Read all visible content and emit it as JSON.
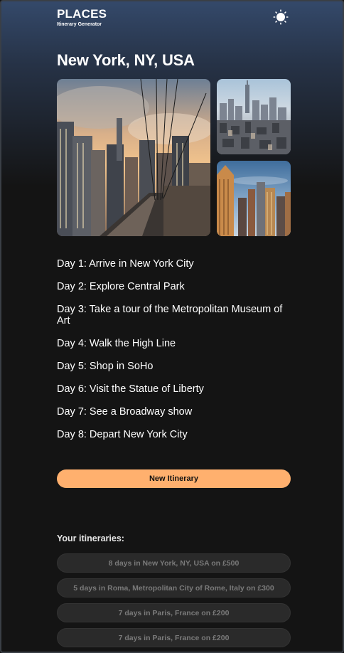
{
  "header": {
    "brand": "PLACES",
    "subtitle": "Itinerary Generator",
    "theme_icon": "sun-icon"
  },
  "destination": {
    "title": "New York, NY, USA",
    "photos": [
      "city-skyline-bridge-photo",
      "aerial-manhattan-photo",
      "skyscrapers-sunset-photo"
    ]
  },
  "itinerary": {
    "days": [
      "Day 1: Arrive in New York City",
      "Day 2: Explore Central Park",
      "Day 3: Take a tour of the Metropolitan Museum of Art",
      "Day 4: Walk the High Line",
      "Day 5: Shop in SoHo",
      "Day 6: Visit the Statue of Liberty",
      "Day 7: See a Broadway show",
      "Day 8: Depart New York City"
    ]
  },
  "actions": {
    "new_itinerary_label": "New Itinerary"
  },
  "saved": {
    "heading": "Your itineraries:",
    "items": [
      "8 days in New York, NY, USA on £500",
      "5 days in Roma, Metropolitan City of Rome, Italy on £300",
      "7 days in Paris, France on £200",
      "7 days in Paris, France on £200"
    ]
  },
  "colors": {
    "accent": "#ffb06e",
    "background": "#141414",
    "header_gradient": "#34496a"
  }
}
